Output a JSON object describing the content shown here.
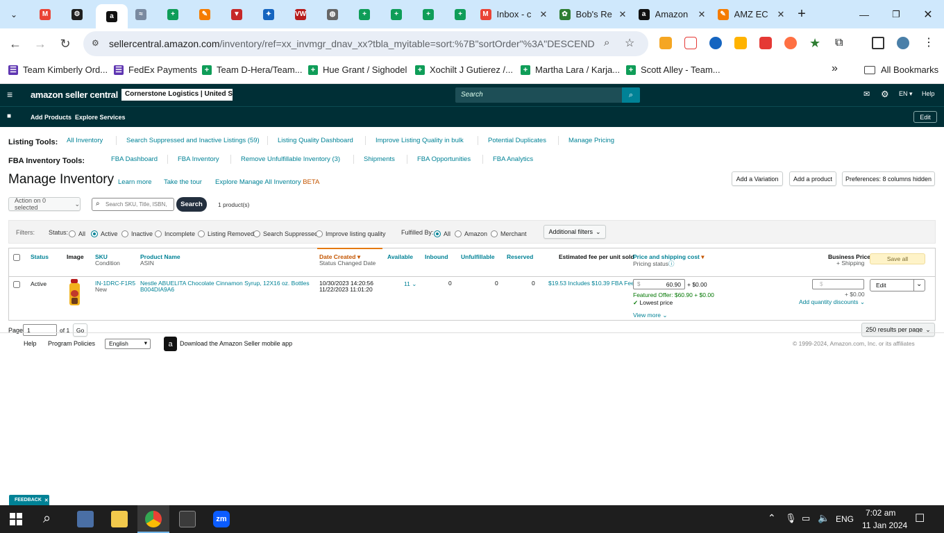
{
  "browser": {
    "tabs": [
      {
        "label": "",
        "icon": "gmail-icon",
        "color": "#ea4335",
        "glyph": "M"
      },
      {
        "label": "",
        "icon": "chatgpt-icon",
        "color": "#1f1f1f",
        "glyph": "⚙"
      },
      {
        "label": "",
        "icon": "amazon-icon",
        "color": "#111",
        "glyph": "a",
        "active": true
      },
      {
        "label": "",
        "icon": "app-icon",
        "color": "#7a8aa0",
        "glyph": "≈"
      },
      {
        "label": "",
        "icon": "sheets-icon",
        "color": "#0f9d58",
        "glyph": "+"
      },
      {
        "label": "",
        "icon": "orange-app-icon",
        "color": "#f57c00",
        "glyph": "✎"
      },
      {
        "label": "",
        "icon": "red-app-icon",
        "color": "#c62828",
        "glyph": "▼"
      },
      {
        "label": "",
        "icon": "blue-app-icon",
        "color": "#1565c0",
        "glyph": "✦"
      },
      {
        "label": "",
        "icon": "vw-icon",
        "color": "#b71c1c",
        "glyph": "VW"
      },
      {
        "label": "",
        "icon": "globe-icon",
        "color": "#666",
        "glyph": "◍"
      },
      {
        "label": "",
        "icon": "sheets-icon",
        "color": "#0f9d58",
        "glyph": "+"
      },
      {
        "label": "",
        "icon": "sheets-icon",
        "color": "#0f9d58",
        "glyph": "+"
      },
      {
        "label": "",
        "icon": "sheets-icon",
        "color": "#0f9d58",
        "glyph": "+"
      },
      {
        "label": "",
        "icon": "sheets-icon",
        "color": "#0f9d58",
        "glyph": "+"
      },
      {
        "label": "Inbox - c",
        "icon": "gmail-icon",
        "color": "#ea4335",
        "glyph": "M"
      },
      {
        "label": "Bob's Re",
        "icon": "leaf-icon",
        "color": "#2e7d32",
        "glyph": "✿"
      },
      {
        "label": "Amazon",
        "icon": "amazon-icon",
        "color": "#111",
        "glyph": "a"
      },
      {
        "label": "AMZ EC",
        "icon": "orange-app-icon",
        "color": "#f57c00",
        "glyph": "✎"
      }
    ],
    "url_host": "sellercentral.amazon.com",
    "url_path": "/inventory/ref=xx_invmgr_dnav_xx?tbla_myitable=sort:%7B\"sortOrder\"%3A\"DESCENDI...",
    "bookmarks": [
      {
        "label": "Team Kimberly Ord...",
        "color": "#5e35b1",
        "glyph": "☰"
      },
      {
        "label": "FedEx Payments",
        "color": "#5e35b1",
        "glyph": "☰"
      },
      {
        "label": "Team D-Hera/Team...",
        "color": "#0f9d58",
        "glyph": "+"
      },
      {
        "label": "Hue Grant / Sighodel",
        "color": "#0f9d58",
        "glyph": "+"
      },
      {
        "label": "Xochilt J Gutierez /...",
        "color": "#0f9d58",
        "glyph": "+"
      },
      {
        "label": "Martha Lara / Karja...",
        "color": "#0f9d58",
        "glyph": "+"
      },
      {
        "label": "Scott Alley - Team...",
        "color": "#0f9d58",
        "glyph": "+"
      }
    ],
    "bookmarks_more": "»",
    "all_bookmarks": "All Bookmarks"
  },
  "seller": {
    "logo": "amazon seller central",
    "account": "Cornerstone Logistics | United S...",
    "search_placeholder": "Search",
    "lang": "EN",
    "help": "Help",
    "nav": [
      "Add Products",
      "Explore Services"
    ],
    "edit": "Edit"
  },
  "listing_tools": {
    "label": "Listing Tools:",
    "links": [
      "All Inventory",
      "Search Suppressed and Inactive Listings (59)",
      "Listing Quality Dashboard",
      "Improve Listing Quality in bulk",
      "Potential Duplicates",
      "Manage Pricing"
    ]
  },
  "fba_tools": {
    "label": "FBA Inventory Tools:",
    "links": [
      "FBA Dashboard",
      "FBA Inventory",
      "Remove Unfulfillable Inventory (3)",
      "Shipments",
      "FBA Opportunities",
      "FBA Analytics"
    ]
  },
  "page": {
    "title": "Manage Inventory",
    "learn_more": "Learn more",
    "tour": "Take the tour",
    "explore": "Explore Manage All Inventory",
    "beta": "BETA",
    "add_variation": "Add a Variation",
    "add_product": "Add a product",
    "preferences": "Preferences: 8 columns hidden",
    "action": "Action on 0 selected",
    "search_placeholder": "Search SKU, Title, ISBN,",
    "search_btn": "Search",
    "count": "1 product(s)"
  },
  "filters": {
    "label": "Filters:",
    "status_label": "Status:",
    "status": [
      "All",
      "Active",
      "Inactive",
      "Incomplete",
      "Listing Removed",
      "Search Suppressed",
      "Improve listing quality"
    ],
    "status_selected": "Active",
    "fulfilled_label": "Fulfilled By:",
    "fulfilled": [
      "All",
      "Amazon",
      "Merchant"
    ],
    "fulfilled_selected": "All",
    "additional": "Additional filters"
  },
  "table": {
    "headers": {
      "status": "Status",
      "image": "Image",
      "sku": "SKU",
      "sku_sub": "Condition",
      "name": "Product Name",
      "name_sub": "ASIN",
      "date": "Date Created",
      "date_sub": "Status Changed Date",
      "available": "Available",
      "inbound": "Inbound",
      "unfulfillable": "Unfulfillable",
      "reserved": "Reserved",
      "fee": "Estimated fee per unit sold",
      "price": "Price and shipping cost",
      "price_sub": "Pricing status",
      "business": "Business Price",
      "business_sub": "+ Shipping",
      "save_all": "Save all"
    },
    "row": {
      "status": "Active",
      "sku": "IN-1DRC-F1R5",
      "condition": "New",
      "name": "Nestle ABUELITA Chocolate Cinnamon Syrup, 12X16 oz. Bottles",
      "asin": "B004DIA9A6",
      "date_created": "10/30/2023 14:20:56",
      "status_changed": "11/22/2023 11:01:20",
      "available": "11",
      "inbound": "0",
      "unfulfillable": "0",
      "reserved": "0",
      "fee": "$19.53 Includes $10.39 FBA Fee",
      "price_currency": "$",
      "price": "60.90",
      "price_ship": "+ $0.00",
      "featured": "Featured Offer: $60.90 + $0.00",
      "lowest": "Lowest price",
      "view_more": "View more",
      "business_currency": "$",
      "business_ship": "+ $0.00",
      "qty_discounts": "Add quantity discounts",
      "edit": "Edit"
    }
  },
  "pagination": {
    "page_label": "Page",
    "page": "1",
    "of": "of 1",
    "go": "Go",
    "per_page": "250 results per page"
  },
  "footer": {
    "help": "Help",
    "policies": "Program Policies",
    "lang": "English",
    "app": "Download the Amazon Seller mobile app",
    "copyright": "© 1999-2024, Amazon.com, Inc. or its affiliates"
  },
  "feedback": "FEEDBACK",
  "taskbar": {
    "lang": "ENG",
    "time": "7:02 am",
    "date": "11 Jan 2024"
  }
}
